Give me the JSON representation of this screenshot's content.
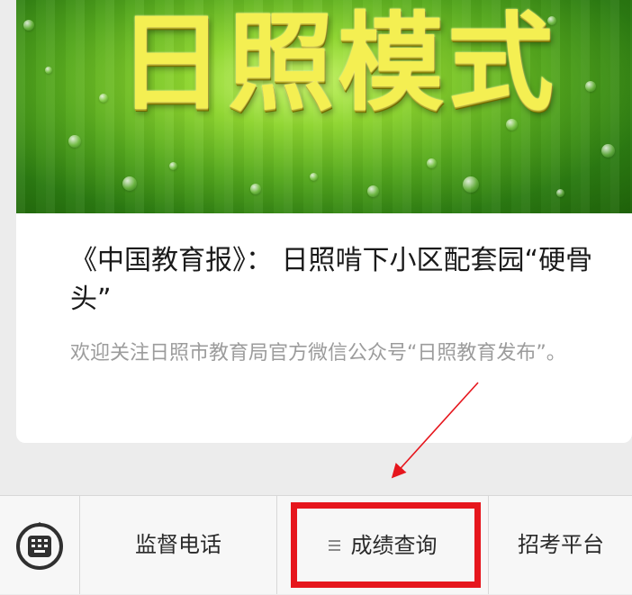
{
  "article": {
    "banner_text": "日照模式",
    "title": "《中国教育报》： 日照啃下小区配套园“硬骨头”",
    "summary": "欢迎关注日照市教育局官方微信公众号“日照教育发布”。"
  },
  "bottom_menu": {
    "keyboard_icon": "keyboard-icon",
    "items": [
      {
        "label": "监督电话"
      },
      {
        "label": "成绩查询",
        "icon": "menu-lines-icon"
      },
      {
        "label": "招考平台"
      }
    ]
  },
  "annotation": {
    "highlight_color": "#e6161d",
    "arrow_color": "#e6161d"
  }
}
